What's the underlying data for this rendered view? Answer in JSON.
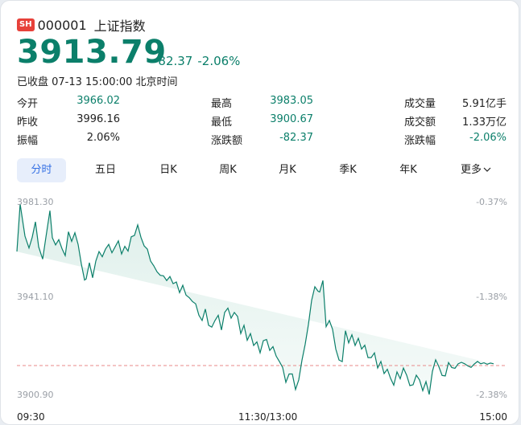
{
  "header": {
    "market_badge": "SH",
    "code": "000001",
    "name": "上证指数"
  },
  "quote": {
    "price": "3913.79",
    "change": "-82.37",
    "change_pct": "-2.06%",
    "status": "已收盘 07-13 15:00:00 北京时间"
  },
  "stats": [
    [
      {
        "label": "今开",
        "value": "3966.02",
        "color": "green"
      },
      {
        "label": "最高",
        "value": "3983.05",
        "color": "green"
      },
      {
        "label": "成交量",
        "value": "5.91亿手",
        "color": "black"
      }
    ],
    [
      {
        "label": "昨收",
        "value": "3996.16",
        "color": "black"
      },
      {
        "label": "最低",
        "value": "3900.67",
        "color": "green"
      },
      {
        "label": "成交额",
        "value": "1.33万亿",
        "color": "black"
      }
    ],
    [
      {
        "label": "振幅",
        "value": "2.06%",
        "color": "black"
      },
      {
        "label": "涨跌额",
        "value": "-82.37",
        "color": "green"
      },
      {
        "label": "涨跌幅",
        "value": "-2.06%",
        "color": "green"
      }
    ]
  ],
  "tabs": [
    {
      "label": "分时",
      "active": true
    },
    {
      "label": "五日",
      "active": false
    },
    {
      "label": "日K",
      "active": false
    },
    {
      "label": "周K",
      "active": false
    },
    {
      "label": "月K",
      "active": false
    },
    {
      "label": "季K",
      "active": false
    },
    {
      "label": "年K",
      "active": false
    },
    {
      "label": "更多",
      "active": false
    }
  ],
  "colors": {
    "up_down_green": "#0b7f6a",
    "active_tab": "#3570e4",
    "prev_close_line": "#e88a8a",
    "badge": "#e7413a"
  },
  "chart_data": {
    "type": "area",
    "title": "",
    "y_left_ticks": [
      "3981.30",
      "3941.10",
      "3900.90"
    ],
    "y_right_ticks": [
      "-0.37%",
      "-1.38%",
      "-2.38%"
    ],
    "x_ticks": [
      "09:30",
      "11:30/13:00",
      "15:00"
    ],
    "ylim": [
      3900.9,
      3981.3
    ],
    "reference_line": 3996.16,
    "x": [
      0,
      4,
      10,
      15,
      19,
      23,
      27,
      32,
      36,
      41,
      44,
      48,
      52,
      56,
      60,
      64,
      68,
      72,
      76,
      80,
      84,
      86,
      90,
      94,
      98,
      102,
      106,
      110,
      114,
      118,
      122,
      126,
      130,
      134,
      138,
      142,
      146,
      150,
      154,
      158,
      162,
      166,
      170,
      174,
      178,
      182,
      186,
      190,
      194,
      198,
      202,
      206,
      210,
      214,
      218,
      222,
      226,
      230,
      234,
      238,
      242,
      246,
      250,
      254,
      258,
      262,
      266,
      270,
      274,
      278,
      282,
      286,
      290,
      294,
      298,
      302,
      306,
      310,
      314,
      318,
      322,
      326,
      330,
      334,
      338,
      342,
      346,
      350,
      354,
      358,
      362,
      366,
      370,
      374,
      376,
      380,
      384,
      388,
      392,
      396,
      400,
      404,
      408,
      412,
      416,
      420,
      424,
      428,
      432,
      436,
      440,
      444,
      448,
      452,
      456,
      460,
      464,
      468,
      472,
      476,
      480,
      484,
      488,
      492,
      496,
      500,
      504,
      508,
      512,
      516,
      520,
      524,
      528,
      532,
      536,
      540,
      544,
      548,
      552,
      556,
      560,
      564,
      568,
      572,
      576,
      580,
      584,
      588,
      592,
      596,
      600,
      604,
      608
    ],
    "y": [
      3961.0,
      3981.0,
      3967.5,
      3962.5,
      3967.0,
      3973.5,
      3963.0,
      3957.8,
      3967.0,
      3978.2,
      3966.8,
      3963.8,
      3966.0,
      3962.2,
      3959.3,
      3969.3,
      3965.3,
      3968.9,
      3964.0,
      3955.8,
      3949.0,
      3949.5,
      3956.3,
      3950.0,
      3957.0,
      3961.0,
      3958.8,
      3962.0,
      3964.0,
      3960.5,
      3963.0,
      3965.5,
      3960.0,
      3963.2,
      3961.2,
      3967.2,
      3967.8,
      3972.2,
      3967.0,
      3963.4,
      3962.0,
      3957.0,
      3955.0,
      3952.5,
      3951.0,
      3950.8,
      3948.8,
      3950.5,
      3947.5,
      3948.2,
      3943.7,
      3946.8,
      3942.7,
      3941.6,
      3940.0,
      3939.0,
      3934.2,
      3932.0,
      3936.8,
      3930.0,
      3929.2,
      3932.0,
      3934.2,
      3928.0,
      3935.4,
      3937.2,
      3933.0,
      3935.4,
      3933.7,
      3926.5,
      3930.0,
      3923.7,
      3926.5,
      3921.5,
      3923.0,
      3918.4,
      3923.5,
      3924.0,
      3919.4,
      3921.0,
      3917.0,
      3914.7,
      3912.3,
      3906.0,
      3909.5,
      3909.5,
      3903.0,
      3907.0,
      3915.3,
      3922.0,
      3930.3,
      3940.5,
      3946.2,
      3944.3,
      3944.0,
      3948.8,
      3929.4,
      3932.0,
      3928.3,
      3920.0,
      3915.4,
      3914.7,
      3927.7,
      3922.6,
      3926.0,
      3921.5,
      3924.5,
      3920.0,
      3921.6,
      3916.4,
      3916.4,
      3918.4,
      3912.0,
      3914.8,
      3909.7,
      3911.5,
      3907.7,
      3904.8,
      3910.4,
      3907.5,
      3912.0,
      3909.0,
      3904.6,
      3905.0,
      3909.0,
      3907.0,
      3902.5,
      3906.3,
      3900.9,
      3910.6,
      3915.5,
      3912.6,
      3908.9,
      3908.7,
      3914.3,
      3912.2,
      3911.9,
      3913.8,
      3914.4,
      3913.8,
      3912.9,
      3912.3,
      3913.7,
      3914.8,
      3913.8,
      3914.2,
      3913.6,
      3914.1,
      3913.79
    ]
  }
}
